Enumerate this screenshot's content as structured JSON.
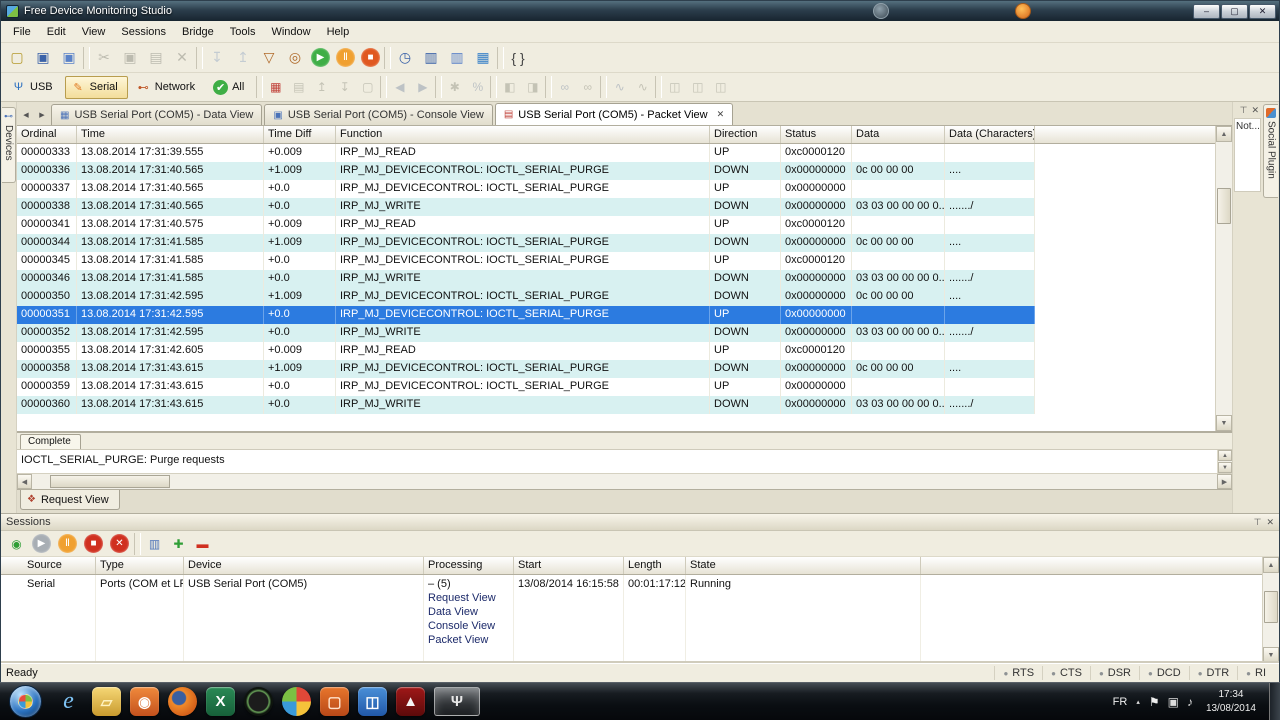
{
  "window": {
    "title": "Free Device Monitoring Studio",
    "minimize": "–",
    "restore": "▢",
    "close": "✕"
  },
  "glyphs": {
    "pin": "⊤",
    "close": "✕",
    "up": "▲",
    "down": "▼",
    "left": "◀",
    "right": "▶"
  },
  "menu": [
    {
      "name": "menu-file",
      "label": "File"
    },
    {
      "name": "menu-edit",
      "label": "Edit"
    },
    {
      "name": "menu-view",
      "label": "View"
    },
    {
      "name": "menu-sessions",
      "label": "Sessions"
    },
    {
      "name": "menu-bridge",
      "label": "Bridge"
    },
    {
      "name": "menu-tools",
      "label": "Tools"
    },
    {
      "name": "menu-window",
      "label": "Window"
    },
    {
      "name": "menu-help",
      "label": "Help"
    }
  ],
  "toolbar_main": [
    {
      "name": "new-file-icon",
      "glyph": "▢",
      "color": "#b59a2e"
    },
    {
      "name": "save-icon",
      "glyph": "▣",
      "color": "#3a62a8"
    },
    {
      "name": "save-all-icon",
      "glyph": "▣",
      "color": "#5a82c8"
    },
    {
      "name": "separator",
      "glyph": "",
      "cls": "sep",
      "inter": "false"
    },
    {
      "name": "cut-icon",
      "glyph": "✂",
      "color": "#77776d",
      "cls": "disabled"
    },
    {
      "name": "copy-icon",
      "glyph": "▣",
      "color": "#77776d",
      "cls": "disabled"
    },
    {
      "name": "paste-icon",
      "glyph": "▤",
      "color": "#77776d",
      "cls": "disabled"
    },
    {
      "name": "delete-icon",
      "glyph": "✕",
      "color": "#77776d",
      "cls": "disabled"
    },
    {
      "name": "separator",
      "glyph": "",
      "cls": "sep",
      "inter": "false"
    },
    {
      "name": "export-icon",
      "glyph": "↧",
      "color": "#8aa0c0",
      "cls": "disabled"
    },
    {
      "name": "import-icon",
      "glyph": "↥",
      "color": "#8aa0c0",
      "cls": "disabled"
    },
    {
      "name": "filter-icon",
      "glyph": "▽",
      "color": "#b06a2a"
    },
    {
      "name": "find-icon",
      "glyph": "◎",
      "color": "#b06a2a"
    },
    {
      "name": "start-monitoring-icon",
      "glyph": "▶",
      "color": "#ffffff",
      "bg": "#3fae46",
      "cls": "round"
    },
    {
      "name": "pause-monitoring-icon",
      "glyph": "Ⅱ",
      "color": "#ffffff",
      "bg": "#f0a030",
      "cls": "round"
    },
    {
      "name": "stop-monitoring-icon",
      "glyph": "■",
      "color": "#ffffff",
      "bg": "#e05820",
      "cls": "round"
    },
    {
      "name": "separator",
      "glyph": "",
      "cls": "sep",
      "inter": "false"
    },
    {
      "name": "hotkeys-icon",
      "glyph": "◷",
      "color": "#3a62a8"
    },
    {
      "name": "window-view-icon",
      "glyph": "▥",
      "color": "#3a62a8"
    },
    {
      "name": "split-view-icon",
      "glyph": "▥",
      "color": "#5a82c8"
    },
    {
      "name": "statistics-icon",
      "glyph": "▦",
      "color": "#3a82c8"
    },
    {
      "name": "separator",
      "glyph": "",
      "cls": "sep",
      "inter": "false"
    },
    {
      "name": "braces-icon",
      "glyph": "{ }",
      "color": "#444444"
    }
  ],
  "device_buttons": [
    {
      "name": "usb-button",
      "label": "USB",
      "glyph": "Ψ",
      "glyph_color": "#2a6fc0"
    },
    {
      "name": "serial-button",
      "label": "Serial",
      "glyph": "✎",
      "glyph_color": "#e07820",
      "cls": "active"
    },
    {
      "name": "network-button",
      "label": "Network",
      "glyph": "⊷",
      "glyph_color": "#c05828"
    },
    {
      "name": "all-button",
      "label": "All",
      "glyph": "✔",
      "glyph_color": "#ffffff",
      "glyph_bg": "#3fae46"
    }
  ],
  "toolbar_packet": [
    {
      "name": "packet-list-icon",
      "glyph": "▦",
      "color": "#c04038"
    },
    {
      "name": "select-packet-icon",
      "glyph": "▤",
      "color": "#8a8a7c",
      "cls": "disabled"
    },
    {
      "name": "first-packet-icon",
      "glyph": "↥",
      "color": "#8a8a7c",
      "cls": "disabled"
    },
    {
      "name": "last-packet-icon",
      "glyph": "↧",
      "color": "#8a8a7c",
      "cls": "disabled"
    },
    {
      "name": "details-icon",
      "glyph": "▢",
      "color": "#8a8a7c",
      "cls": "disabled"
    },
    {
      "name": "separator",
      "glyph": "",
      "cls": "sep",
      "inter": "false"
    },
    {
      "name": "prev-packet-icon",
      "glyph": "◀",
      "color": "#7888a0",
      "cls": "disabled"
    },
    {
      "name": "next-packet-icon",
      "glyph": "▶",
      "color": "#7888a0",
      "cls": "disabled"
    },
    {
      "name": "separator",
      "glyph": "",
      "cls": "sep",
      "inter": "false"
    },
    {
      "name": "filter-setup-icon",
      "glyph": "✱",
      "color": "#8a8a7c",
      "cls": "disabled"
    },
    {
      "name": "statistics2-icon",
      "glyph": "%",
      "color": "#7888a0",
      "cls": "disabled"
    },
    {
      "name": "separator",
      "glyph": "",
      "cls": "sep",
      "inter": "false"
    },
    {
      "name": "split-horizontal-icon",
      "glyph": "◧",
      "color": "#8a8a7c",
      "cls": "disabled"
    },
    {
      "name": "split-vertical-icon",
      "glyph": "◨",
      "color": "#8a8a7c",
      "cls": "disabled"
    },
    {
      "name": "separator",
      "glyph": "",
      "cls": "sep",
      "inter": "false"
    },
    {
      "name": "link-icon",
      "glyph": "∞",
      "color": "#7888a0",
      "cls": "disabled"
    },
    {
      "name": "unlink-icon",
      "glyph": "∞",
      "color": "#8a8a7c",
      "cls": "disabled"
    },
    {
      "name": "separator",
      "glyph": "",
      "cls": "sep",
      "inter": "false"
    },
    {
      "name": "graph-icon",
      "glyph": "∿",
      "color": "#7888a0",
      "cls": "disabled"
    },
    {
      "name": "graph2-icon",
      "glyph": "∿",
      "color": "#8a8a7c",
      "cls": "disabled"
    },
    {
      "name": "separator",
      "glyph": "",
      "cls": "sep",
      "inter": "false"
    },
    {
      "name": "export-data-icon",
      "glyph": "◫",
      "color": "#8a8a7c",
      "cls": "disabled"
    },
    {
      "name": "export-log-icon",
      "glyph": "◫",
      "color": "#8a8a7c",
      "cls": "disabled"
    },
    {
      "name": "export-report-icon",
      "glyph": "◫",
      "color": "#8a8a7c",
      "cls": "disabled"
    }
  ],
  "tabbar": {
    "scroll_left": "◀",
    "scroll_right": "▶"
  },
  "tabs": [
    {
      "name": "tab-data-view",
      "label": "USB Serial Port (COM5) - Data View",
      "glyph": "▦",
      "glyph_color": "#4a72b8"
    },
    {
      "name": "tab-console-view",
      "label": "USB Serial Port (COM5) - Console View",
      "glyph": "▣",
      "glyph_color": "#4a72b8"
    },
    {
      "name": "tab-packet-view",
      "label": "USB Serial Port (COM5) - Packet View",
      "glyph": "▤",
      "glyph_color": "#c04038",
      "close": "✕"
    }
  ],
  "docks": {
    "left_tab": "Devices",
    "left_glyph": "⊷",
    "right_panel_text": "Not...",
    "right_strip": "Social Plugin"
  },
  "packet_table": {
    "header": [
      {
        "label": "Ordinal",
        "cls": "c0"
      },
      {
        "label": "Time",
        "cls": "c1"
      },
      {
        "label": "Time Diff",
        "cls": "c2"
      },
      {
        "label": "Function",
        "cls": "c3"
      },
      {
        "label": "Direction",
        "cls": "c4"
      },
      {
        "label": "Status",
        "cls": "c5"
      },
      {
        "label": "Data",
        "cls": "c6"
      },
      {
        "label": "Data (Characters)",
        "cls": "c7"
      }
    ],
    "rows": [
      {
        "ordinal": "00000333",
        "time": "13.08.2014 17:31:39.555",
        "diff": "+0.009",
        "func": "IRP_MJ_READ",
        "dir": "UP",
        "status": "0xc0000120",
        "data": "",
        "chars": "",
        "cls": ""
      },
      {
        "ordinal": "00000336",
        "time": "13.08.2014 17:31:40.565",
        "diff": "+1.009",
        "func": "IRP_MJ_DEVICECONTROL: IOCTL_SERIAL_PURGE",
        "dir": "DOWN",
        "status": "0x00000000",
        "data": "0c 00 00 00",
        "chars": "....",
        "cls": "shaded"
      },
      {
        "ordinal": "00000337",
        "time": "13.08.2014 17:31:40.565",
        "diff": "+0.0",
        "func": "IRP_MJ_DEVICECONTROL: IOCTL_SERIAL_PURGE",
        "dir": "UP",
        "status": "0x00000000",
        "data": "",
        "chars": "",
        "cls": ""
      },
      {
        "ordinal": "00000338",
        "time": "13.08.2014 17:31:40.565",
        "diff": "+0.0",
        "func": "IRP_MJ_WRITE",
        "dir": "DOWN",
        "status": "0x00000000",
        "data": "03 03 00 00 00 0...",
        "chars": "......./",
        "cls": "shaded"
      },
      {
        "ordinal": "00000341",
        "time": "13.08.2014 17:31:40.575",
        "diff": "+0.009",
        "func": "IRP_MJ_READ",
        "dir": "UP",
        "status": "0xc0000120",
        "data": "",
        "chars": "",
        "cls": ""
      },
      {
        "ordinal": "00000344",
        "time": "13.08.2014 17:31:41.585",
        "diff": "+1.009",
        "func": "IRP_MJ_DEVICECONTROL: IOCTL_SERIAL_PURGE",
        "dir": "DOWN",
        "status": "0x00000000",
        "data": "0c 00 00 00",
        "chars": "....",
        "cls": "shaded"
      },
      {
        "ordinal": "00000345",
        "time": "13.08.2014 17:31:41.585",
        "diff": "+0.0",
        "func": "IRP_MJ_DEVICECONTROL: IOCTL_SERIAL_PURGE",
        "dir": "UP",
        "status": "0xc0000120",
        "data": "",
        "chars": "",
        "cls": ""
      },
      {
        "ordinal": "00000346",
        "time": "13.08.2014 17:31:41.585",
        "diff": "+0.0",
        "func": "IRP_MJ_WRITE",
        "dir": "DOWN",
        "status": "0x00000000",
        "data": "03 03 00 00 00 0...",
        "chars": "......./",
        "cls": "shaded"
      },
      {
        "ordinal": "00000350",
        "time": "13.08.2014 17:31:42.595",
        "diff": "+1.009",
        "func": "IRP_MJ_DEVICECONTROL: IOCTL_SERIAL_PURGE",
        "dir": "DOWN",
        "status": "0x00000000",
        "data": "0c 00 00 00",
        "chars": "....",
        "cls": "shaded"
      },
      {
        "ordinal": "00000351",
        "time": "13.08.2014 17:31:42.595",
        "diff": "+0.0",
        "func": "IRP_MJ_DEVICECONTROL: IOCTL_SERIAL_PURGE",
        "dir": "UP",
        "status": "0x00000000",
        "data": "",
        "chars": "",
        "cls": "selected"
      },
      {
        "ordinal": "00000352",
        "time": "13.08.2014 17:31:42.595",
        "diff": "+0.0",
        "func": "IRP_MJ_WRITE",
        "dir": "DOWN",
        "status": "0x00000000",
        "data": "03 03 00 00 00 0...",
        "chars": "......./",
        "cls": "shaded"
      },
      {
        "ordinal": "00000355",
        "time": "13.08.2014 17:31:42.605",
        "diff": "+0.009",
        "func": "IRP_MJ_READ",
        "dir": "UP",
        "status": "0xc0000120",
        "data": "",
        "chars": "",
        "cls": ""
      },
      {
        "ordinal": "00000358",
        "time": "13.08.2014 17:31:43.615",
        "diff": "+1.009",
        "func": "IRP_MJ_DEVICECONTROL: IOCTL_SERIAL_PURGE",
        "dir": "DOWN",
        "status": "0x00000000",
        "data": "0c 00 00 00",
        "chars": "....",
        "cls": "shaded"
      },
      {
        "ordinal": "00000359",
        "time": "13.08.2014 17:31:43.615",
        "diff": "+0.0",
        "func": "IRP_MJ_DEVICECONTROL: IOCTL_SERIAL_PURGE",
        "dir": "UP",
        "status": "0x00000000",
        "data": "",
        "chars": "",
        "cls": ""
      },
      {
        "ordinal": "00000360",
        "time": "13.08.2014 17:31:43.615",
        "diff": "+0.0",
        "func": "IRP_MJ_WRITE",
        "dir": "DOWN",
        "status": "0x00000000",
        "data": "03 03 00 00 00 0...",
        "chars": "......./",
        "cls": "shaded"
      }
    ]
  },
  "detail": {
    "tab_label": "Complete",
    "content": "IOCTL_SERIAL_PURGE: Purge requests",
    "request_tab": "Request View",
    "request_tab_glyph": "❖"
  },
  "sessions": {
    "title": "Sessions",
    "toolbar": [
      {
        "name": "new-session-icon",
        "glyph": "◉",
        "color": "#2f9e36"
      },
      {
        "name": "start-session-icon",
        "glyph": "▶",
        "color": "#ffffff",
        "bg": "#a8aeb4",
        "cls": "round"
      },
      {
        "name": "pause-session-icon",
        "glyph": "Ⅱ",
        "color": "#ffffff",
        "bg": "#f0a030",
        "cls": "round"
      },
      {
        "name": "stop-session-icon",
        "glyph": "■",
        "color": "#ffffff",
        "bg": "#d03020",
        "cls": "round"
      },
      {
        "name": "close-session-icon",
        "glyph": "✕",
        "color": "#ffffff",
        "bg": "#d03020",
        "cls": "round"
      },
      {
        "name": "separator",
        "glyph": "",
        "cls": "sep",
        "inter": "false"
      },
      {
        "name": "session-statistics-icon",
        "glyph": "▥",
        "color": "#4a72b8"
      },
      {
        "name": "add-session-icon",
        "glyph": "✚",
        "color": "#2f9e36"
      },
      {
        "name": "remove-session-icon",
        "glyph": "▬",
        "color": "#d03020"
      }
    ],
    "header": [
      {
        "label": "Source",
        "cls": "s0"
      },
      {
        "label": "Type",
        "cls": "s1"
      },
      {
        "label": "Device",
        "cls": "s2"
      },
      {
        "label": "Processing",
        "cls": "s3"
      },
      {
        "label": "Start",
        "cls": "s4"
      },
      {
        "label": "Length",
        "cls": "s5"
      },
      {
        "label": "State",
        "cls": "s6"
      }
    ],
    "row": {
      "source": "Serial",
      "type": "Ports (COM et LPT)",
      "device": "USB Serial Port (COM5)",
      "processing_head": "– (5)",
      "processing_links": [
        "Request View",
        "Data View",
        "Console View",
        "Packet View"
      ],
      "start": "13/08/2014 16:15:58",
      "length": "00:01:17:12",
      "state": "Running"
    }
  },
  "statusbar": {
    "ready": "Ready",
    "leds": [
      {
        "name": "led-rts",
        "label": "RTS",
        "dot": "●"
      },
      {
        "name": "led-cts",
        "label": "CTS",
        "dot": "●"
      },
      {
        "name": "led-dsr",
        "label": "DSR",
        "dot": "●"
      },
      {
        "name": "led-dcd",
        "label": "DCD",
        "dot": "●"
      },
      {
        "name": "led-dtr",
        "label": "DTR",
        "dot": "●"
      },
      {
        "name": "led-ri",
        "label": "RI",
        "dot": "●"
      }
    ]
  },
  "taskbar": {
    "items": [
      {
        "name": "taskbar-internet-explorer",
        "glyph": "e",
        "color": "#7ec3f5",
        "bg": "transparent",
        "cls": "ie"
      },
      {
        "name": "taskbar-explorer",
        "glyph": "▱",
        "color": "#fff2c0",
        "bg": "linear-gradient(#f6d776,#c99b2e)",
        "cls": "chip"
      },
      {
        "name": "taskbar-media-player",
        "glyph": "◉",
        "color": "#ffffff",
        "bg": "linear-gradient(#f08a3c,#c4511d)",
        "cls": "chip"
      },
      {
        "name": "taskbar-firefox",
        "glyph": "",
        "color": "#ffffff",
        "bg": "radial-gradient(circle at 38% 38%, #3a5fa0 26%, #f08a2a 30%, #d4601a 72%)",
        "cls": "circle"
      },
      {
        "name": "taskbar-excel",
        "glyph": "X",
        "color": "#ffffff",
        "bg": "linear-gradient(#2a8a55,#17603a)",
        "cls": "chip"
      },
      {
        "name": "taskbar-monitor-app",
        "glyph": "",
        "color": "#88cc88",
        "bg": "radial-gradient(circle, #1c1c1c 46%, #6aa55a 52%, #0e140e 62%)",
        "cls": "circle"
      },
      {
        "name": "taskbar-paint-app",
        "glyph": "",
        "color": "#ffffff",
        "bg": "conic-gradient(#e04838 0 25%, #f5c23a 0 50%, #3a9ad9 0 75%, #7bc043 0)",
        "cls": "circle"
      },
      {
        "name": "taskbar-office-app",
        "glyph": "▢",
        "color": "#ffe0c8",
        "bg": "linear-gradient(#e8762c,#b84818)",
        "cls": "chip"
      },
      {
        "name": "taskbar-photo-viewer",
        "glyph": "◫",
        "color": "#ffffff",
        "bg": "linear-gradient(#4a90d8,#2158a8)",
        "cls": "chip"
      },
      {
        "name": "taskbar-adobe-reader",
        "glyph": "▲",
        "color": "#f5f5f5",
        "bg": "linear-gradient(#a01818,#5c0a0a)",
        "cls": "chip"
      },
      {
        "name": "taskbar-usb-monitor",
        "glyph": "Ψ",
        "color": "#e8e8e8",
        "bg": "linear-gradient(rgba(255,255,255,.28),rgba(255,255,255,.08))",
        "cls": "chip active"
      }
    ],
    "tray_icons": [
      {
        "name": "tray-action-center-icon",
        "glyph": "⚑",
        "color": "#eeeeee"
      },
      {
        "name": "tray-network-icon",
        "glyph": "▣",
        "color": "#dddddd"
      },
      {
        "name": "tray-volume-icon",
        "glyph": "♪",
        "color": "#dddddd"
      }
    ],
    "tray": {
      "lang": "FR",
      "chevron": "▴",
      "time": "17:34",
      "date": "13/08/2014"
    }
  }
}
